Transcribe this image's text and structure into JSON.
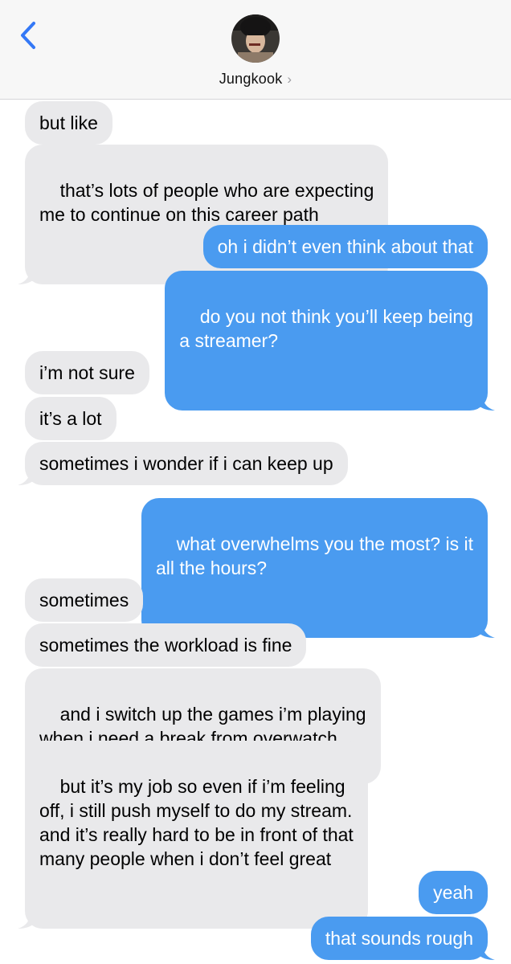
{
  "header": {
    "contact_name": "Jungkook",
    "back_icon": "chevron-left-icon",
    "details_icon": "chevron-right-icon"
  },
  "colors": {
    "incoming_bubble": "#e9e9eb",
    "outgoing_bubble": "#4a9bf0",
    "accent": "#3478f6"
  },
  "messages": [
    {
      "direction": "incoming",
      "text": "but like"
    },
    {
      "direction": "incoming",
      "text": "that’s lots of people who are expecting\nme to continue on this career path"
    },
    {
      "direction": "outgoing",
      "text": "oh i didn’t even think about that"
    },
    {
      "direction": "outgoing",
      "text": "do you not think you’ll keep being\na streamer?"
    },
    {
      "direction": "incoming",
      "text": "i’m not sure"
    },
    {
      "direction": "incoming",
      "text": "it’s a lot"
    },
    {
      "direction": "incoming",
      "text": "sometimes i wonder if i can keep up"
    },
    {
      "direction": "outgoing",
      "text": "what overwhelms you the most? is it\nall the hours?"
    },
    {
      "direction": "incoming",
      "text": "sometimes"
    },
    {
      "direction": "incoming",
      "text": "sometimes the workload is fine"
    },
    {
      "direction": "incoming",
      "text": "and i switch up the games i’m playing\nwhen i need a break from overwatch"
    },
    {
      "direction": "incoming",
      "text": "but it’s my job so even if i’m feeling\noff, i still push myself to do my stream.\nand it’s really hard to be in front of that\nmany people when i don’t feel great"
    },
    {
      "direction": "outgoing",
      "text": "yeah"
    },
    {
      "direction": "outgoing",
      "text": "that sounds rough"
    }
  ]
}
